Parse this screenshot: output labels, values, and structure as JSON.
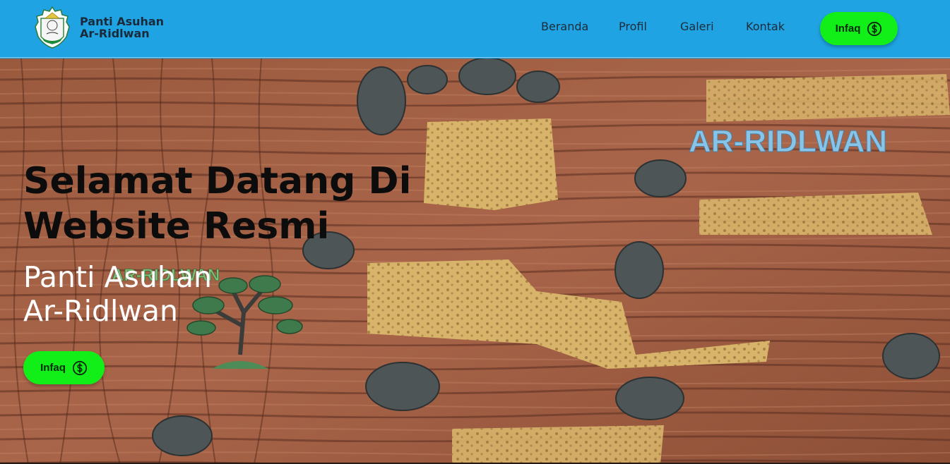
{
  "brand": {
    "name_line1": "Panti Asuhan",
    "name_line2": "Ar-Ridlwan"
  },
  "nav": {
    "items": [
      {
        "label": "Beranda"
      },
      {
        "label": "Profil"
      },
      {
        "label": "Galeri"
      },
      {
        "label": "Kontak"
      }
    ],
    "infaq_label": "Infaq"
  },
  "hero": {
    "title_line1": "Selamat Datang Di",
    "title_line2": "Website Resmi",
    "subtitle_line1": "Panti Asuhan",
    "subtitle_line2": "Ar-Ridlwan",
    "infaq_label": "Infaq",
    "wall_sign": "AR-RIDLWAN",
    "wall_sign_small": "AR-RIDLWAN"
  },
  "colors": {
    "header_bg": "#1fa3e3",
    "button_bg": "#11ee18",
    "title_text": "#0c0c0c",
    "subtitle_text": "#ffffff"
  },
  "icons": {
    "logo": "emblem-logo",
    "infaq": "dollar-circle-icon"
  }
}
